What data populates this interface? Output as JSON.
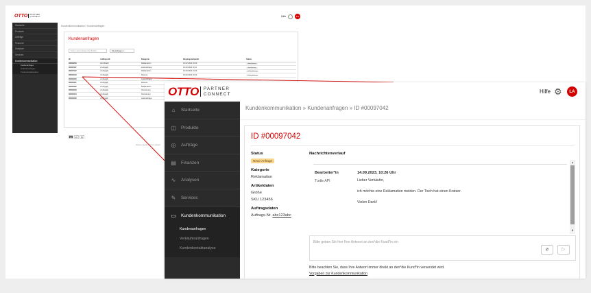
{
  "colors": {
    "accent": "#d40000",
    "sidebar": "#2b2b2b",
    "badge_new": "#f8d58e",
    "zoom_line": "#d40000"
  },
  "brand": {
    "logo_text": "OTTO",
    "partner_line1": "PARTNER",
    "partner_line2": "CONNECT"
  },
  "header": {
    "help_label": "Hilfe",
    "gear_icon": "gear-icon",
    "avatar_initials": "LA"
  },
  "sidebar": {
    "items": [
      {
        "label": "Startseite",
        "icon": "home-icon"
      },
      {
        "label": "Produkte",
        "icon": "box-icon"
      },
      {
        "label": "Aufträge",
        "icon": "orders-icon"
      },
      {
        "label": "Finanzen",
        "icon": "finance-icon"
      },
      {
        "label": "Analysen",
        "icon": "chart-icon"
      },
      {
        "label": "Services",
        "icon": "services-icon"
      },
      {
        "label": "Kundenkommunikation",
        "icon": "chat-icon"
      }
    ],
    "subitems": [
      "Kundenanfragen",
      "Verkäuferanfragen",
      "Kundenkontaktanalyse"
    ]
  },
  "mini": {
    "breadcrumb": "Kundenkommunikation » Kundenanfragen",
    "panel_title": "Kundenanfragen",
    "search_placeholder": "Suche nach Anfrage-IDs, Bestell...",
    "filter_value": "Alle Anfragen",
    "columns": [
      "ID",
      "Auftrags-Nr.",
      "Kategorie",
      "Eingangszeitpunkt",
      "Status"
    ],
    "rows": [
      {
        "id": "00006293",
        "order": "abc123abc",
        "cat": "Reklamation",
        "time": "14.02.2023 15:23",
        "status": "Geschlossen"
      },
      {
        "id": "00003037",
        "order": "cln-fkgsjdj",
        "cat": "Lieferanfrage",
        "time": "10.09.2023 15:11",
        "status": "Geschlossen"
      },
      {
        "id": "00007042",
        "order": "cln-fkgsjdj",
        "cat": "Reklamation",
        "time": "10.09.2023 10:26",
        "status": "In Bearbeitung"
      },
      {
        "id": "00003049",
        "order": "cln-fkgsjdj",
        "cat": "Retoure",
        "time": "10.09.2023 10:23",
        "status": "In Bearbeitung"
      },
      {
        "id": "00003030",
        "order": "cln-fkgsjdj",
        "cat": "Lieferanfrage",
        "time": "",
        "status": ""
      },
      {
        "id": "00003031",
        "order": "cln-fkgsjdj",
        "cat": "Retoure",
        "time": "",
        "status": ""
      },
      {
        "id": "00003032",
        "order": "cln-fkgsjdj",
        "cat": "Reklamation",
        "time": "",
        "status": ""
      },
      {
        "id": "00003033",
        "order": "cln-fkgsjdj",
        "cat": "Stornierung",
        "time": "",
        "status": ""
      },
      {
        "id": "00003034",
        "order": "cln-fkgsjdj",
        "cat": "Stornierung",
        "time": "",
        "status": ""
      },
      {
        "id": "00003036",
        "order": "cln-fkgsjdj",
        "cat": "Lieferanfrage",
        "time": "",
        "status": ""
      }
    ],
    "pager": [
      "10",
      "20",
      "50"
    ],
    "hint": "Weitere Nachrichten im Verlauf"
  },
  "detail": {
    "breadcrumb": "Kundenkommunikation » Kundenanfragen » ID #00097042",
    "title": "ID #00097042",
    "status_label": "Status",
    "status_value": "Neue Anfrage",
    "category_label": "Kategorie",
    "category_value": "Reklamation",
    "article_label": "Artikeldaten",
    "size_value": "Größe",
    "sku_value": "SKU 123456",
    "order_label": "Auftragsdaten",
    "order_prefix": "Auftrags-Nr.",
    "order_link": "abc123abc",
    "history_label": "Nachrichtenverlauf",
    "message": {
      "author_label": "Bearbeiter*in",
      "date": "14.09.2023, 10:26 Uhr",
      "sender": "Turtle API",
      "lines": [
        "Lieber Verkäufer,",
        "ich möchte eine Reklamation melden. Der Tisch hat einen Kratzer.",
        "Vielen Dank!"
      ]
    },
    "reply_placeholder": "Bitte geben Sie hier Ihre Antwort an den*die Kund*in ein",
    "note": "Bitte beachten Sie, dass Ihre Antwort immer direkt an den*die Kund*in versendet wird.",
    "note_link": "Vorgaben zur Kundenkommunikation"
  }
}
